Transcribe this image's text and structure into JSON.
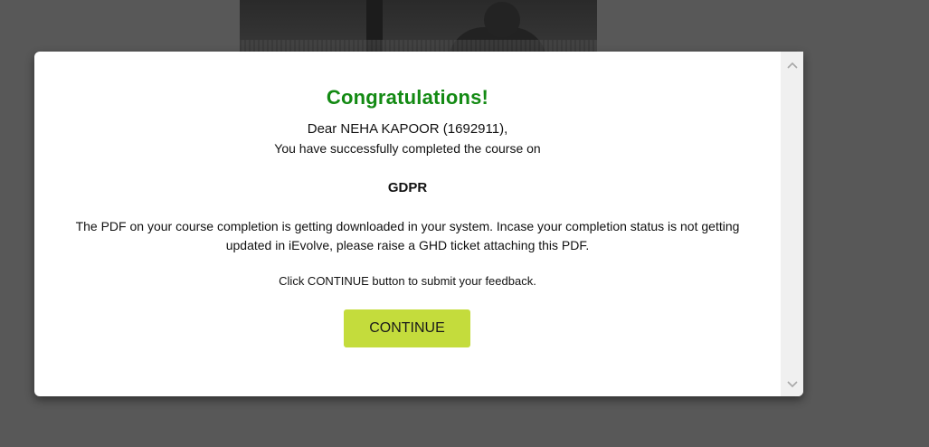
{
  "modal": {
    "title": "Congratulations!",
    "greeting": "Dear NEHA KAPOOR (1692911),",
    "completed_line": "You have successfully completed the course on",
    "course_name": "GDPR",
    "pdf_note": "The PDF on your course completion is getting downloaded in your system. Incase your completion status is not getting updated in iEvolve, please raise a GHD ticket attaching this PDF.",
    "click_note": "Click CONTINUE button to submit your feedback.",
    "continue_label": "CONTINUE"
  },
  "colors": {
    "title": "#138a13",
    "continue_button": "#c4dc3c",
    "overlay": "#585858",
    "scrollbar_track": "#f0f0f0"
  },
  "icons": {
    "scroll_up": "chevron-up-icon",
    "scroll_down": "chevron-down-icon"
  }
}
